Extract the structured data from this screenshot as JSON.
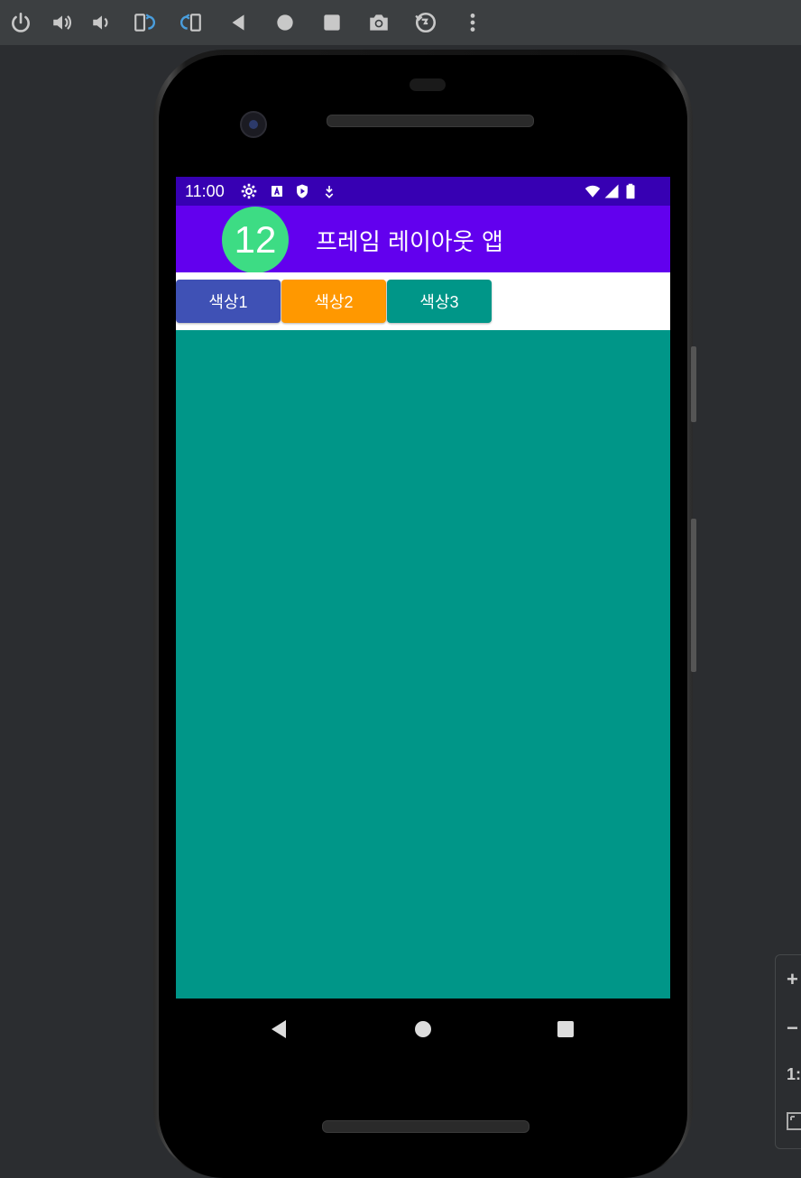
{
  "toolbar": {
    "icons": [
      "power-icon",
      "volume-up-icon",
      "volume-down-icon",
      "rotate-left-icon",
      "rotate-right-icon",
      "back-icon",
      "home-icon",
      "overview-icon",
      "screenshot-icon",
      "snapshot-icon",
      "more-icon"
    ]
  },
  "status_bar": {
    "time": "11:00",
    "icons": [
      "settings-icon",
      "accessibility-icon",
      "shield-icon",
      "download-icon",
      "wifi-icon",
      "signal-icon",
      "battery-icon"
    ]
  },
  "app_bar": {
    "logo_text": "12",
    "title": "프레임 레이아웃 앱"
  },
  "buttons": [
    {
      "label": "색상1",
      "color": "#3f51b5"
    },
    {
      "label": "색상2",
      "color": "#ff9800"
    },
    {
      "label": "색상3",
      "color": "#009688"
    }
  ],
  "frame": {
    "color": "#009688"
  },
  "nav_bar": {
    "icons": [
      "nav-back-icon",
      "nav-home-icon",
      "nav-recents-icon"
    ]
  },
  "zoom_panel": {
    "zoom_in": "+",
    "zoom_out": "−",
    "actual_size": "1:"
  },
  "colors": {
    "status_bar": "#3700b3",
    "app_bar": "#6200ee",
    "logo": "#3ddc84"
  }
}
